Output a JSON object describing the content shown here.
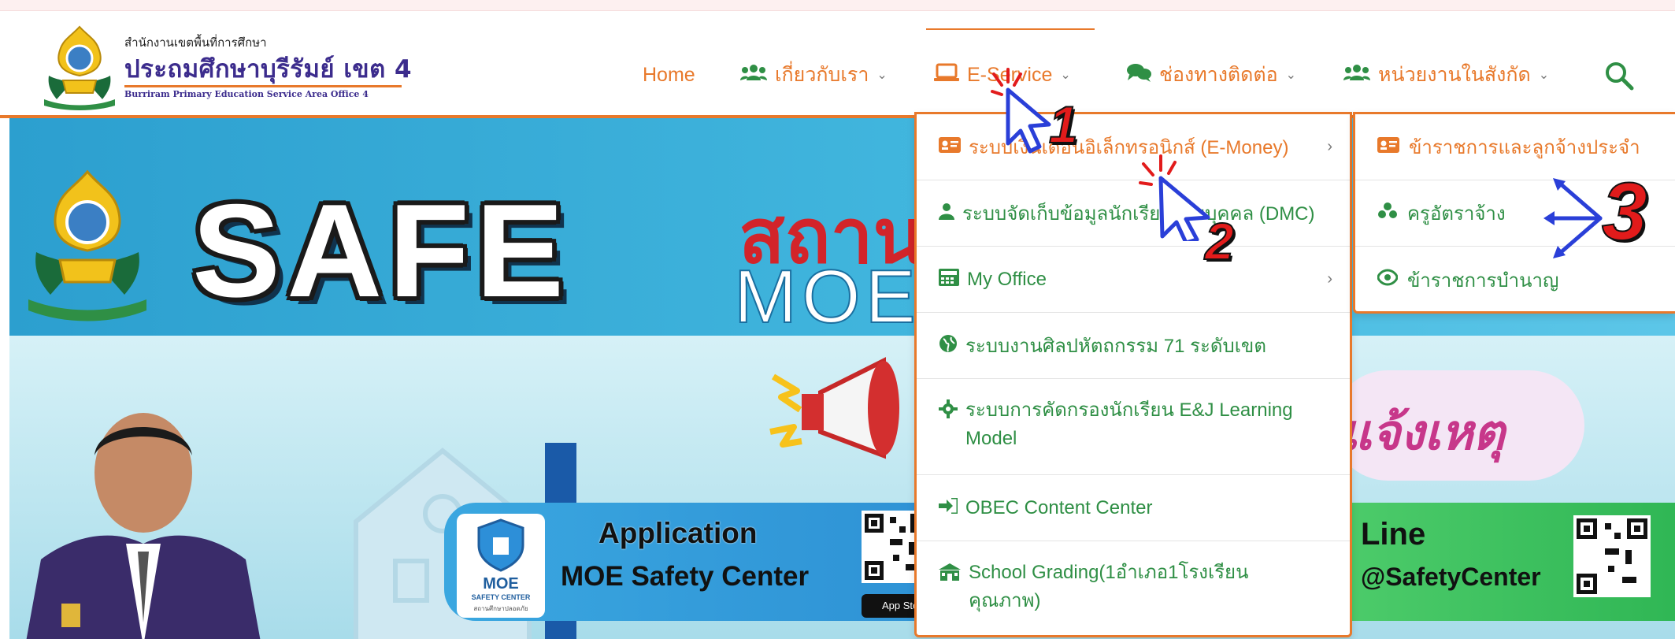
{
  "header": {
    "logo_small": "สำนักงานเขตพื้นที่การศึกษา",
    "logo_title": "ประถมศึกษาบุรีรัมย์ เขต 4",
    "logo_en": "Burriram Primary Education Service Area Office 4"
  },
  "nav": {
    "home": "Home",
    "about": "เกี่ยวกับเรา",
    "eservice": "E-Service",
    "contact": "ช่องทางติดต่อ",
    "units": "หน่วยงานในสังกัด"
  },
  "dropdown": {
    "items": [
      {
        "label": "ระบบเงินเดือนอิเล็กทรอนิกส์ (E-Money)",
        "icon": "id-card-icon"
      },
      {
        "label": "ระบบจัดเก็บข้อมูลนักเรียนรายบุคคล (DMC)",
        "icon": "user-icon"
      },
      {
        "label": "My Office",
        "icon": "calculator-icon"
      },
      {
        "label": "ระบบงานศิลปหัตถกรรม 71 ระดับเขต",
        "icon": "globe-icon"
      },
      {
        "label": "ระบบการคัดกรองนักเรียน E&J Learning Model",
        "icon": "gear-icon"
      },
      {
        "label": "OBEC Content Center",
        "icon": "sign-in-icon"
      },
      {
        "label": "School Grading(1อำเภอ1โรงเรียนคุณภาพ)",
        "icon": "school-icon"
      }
    ]
  },
  "submenu": {
    "items": [
      {
        "label": "ข้าราชการและลูกจ้างประจำ",
        "icon": "id-card-icon"
      },
      {
        "label": "ครูอัตราจ้าง",
        "icon": "users-icon"
      },
      {
        "label": "ข้าราชการบำนาญ",
        "icon": "eye-icon"
      }
    ]
  },
  "banner": {
    "safe": "SAFE",
    "thai_red": "สถานศึ",
    "moe": "MOE S",
    "report": "แจ้งเหตุ",
    "moe_box_1": "MOE",
    "moe_box_2": "SAFETY CENTER",
    "moe_box_3": "สถานศึกษาปลอดภัย",
    "app_title": "Application",
    "app_sub": "MOE Safety Center",
    "appstore": "App Store",
    "line_title": "Line",
    "line_sub": "@SafetyCenter"
  },
  "annotations": {
    "one": "1",
    "two": "2",
    "three": "3"
  },
  "colors": {
    "accent": "#e8792b",
    "nav_icon": "#2f8f45",
    "brand": "#3c2c8d",
    "annotation_red": "#e21b1b",
    "arrow_blue": "#2a3fd8"
  }
}
